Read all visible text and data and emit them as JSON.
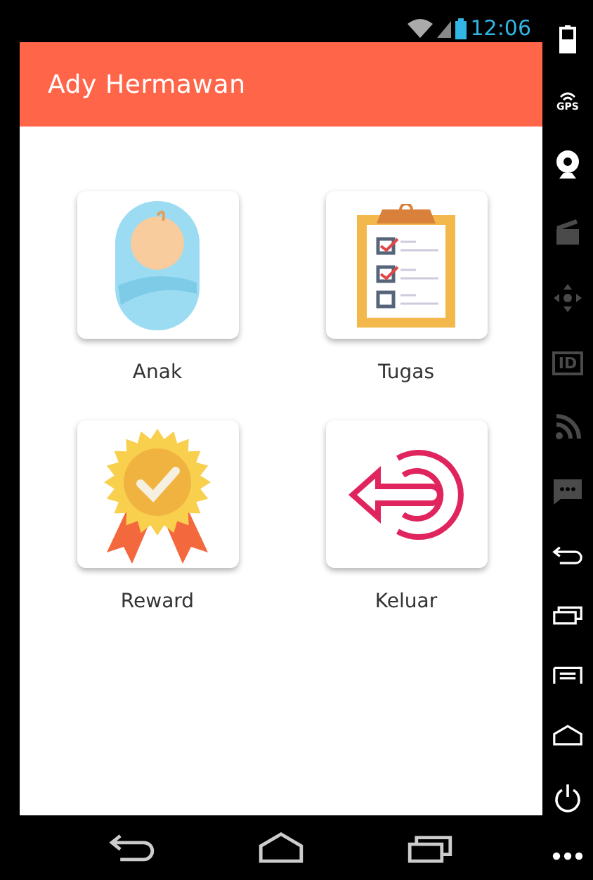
{
  "status_bar": {
    "time": "12:06"
  },
  "app_bar": {
    "title": "Ady Hermawan"
  },
  "menu": [
    {
      "label": "Anak",
      "kind": "baby"
    },
    {
      "label": "Tugas",
      "kind": "clipboard"
    },
    {
      "label": "Reward",
      "kind": "badge"
    },
    {
      "label": "Keluar",
      "kind": "logout"
    }
  ],
  "nav_bar": [
    {
      "kind": "back"
    },
    {
      "kind": "home"
    },
    {
      "kind": "recent"
    }
  ],
  "emulator_toolbar": [
    {
      "kind": "battery",
      "disabled": false
    },
    {
      "kind": "gps",
      "label": "GPS",
      "disabled": false
    },
    {
      "kind": "camera",
      "disabled": false
    },
    {
      "kind": "clapper",
      "disabled": true
    },
    {
      "kind": "dpad",
      "disabled": true
    },
    {
      "kind": "id",
      "label": "ID",
      "disabled": true
    },
    {
      "kind": "rss",
      "disabled": true
    },
    {
      "kind": "sms",
      "disabled": true
    },
    {
      "kind": "back",
      "disabled": false
    },
    {
      "kind": "recent",
      "disabled": false
    },
    {
      "kind": "menu",
      "disabled": false
    },
    {
      "kind": "home",
      "disabled": false
    },
    {
      "kind": "power",
      "disabled": false
    },
    {
      "kind": "more",
      "disabled": false
    }
  ]
}
